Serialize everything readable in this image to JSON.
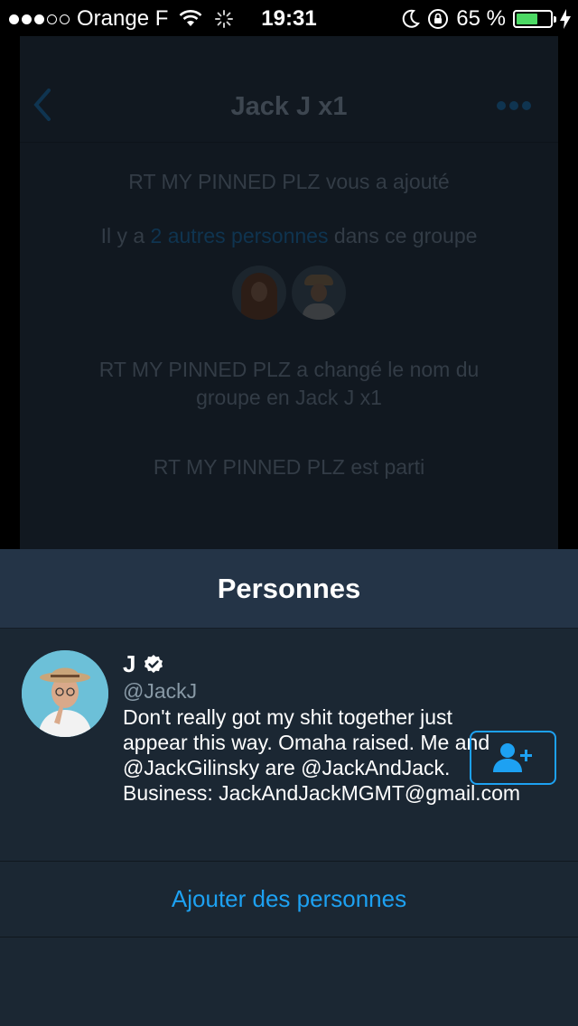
{
  "status_bar": {
    "carrier": "Orange F",
    "time": "19:31",
    "battery_text": "65 %",
    "battery_level": 0.65,
    "battery_color": "#4cd964"
  },
  "background_conversation": {
    "title": "Jack J x1",
    "back_icon": "chevron-left-icon",
    "more_icon": "more-dots-icon",
    "msg_added": "RT MY PINNED PLZ vous a ajouté",
    "msg_others_prefix": "Il y a ",
    "msg_others_link": "2 autres personnes",
    "msg_others_suffix": " dans ce groupe",
    "msg_renamed_line1": "RT MY PINNED PLZ a changé le nom du",
    "msg_renamed_line2": "groupe en Jack J x1",
    "msg_left": "RT MY PINNED PLZ est parti"
  },
  "sheet": {
    "title": "Personnes",
    "people": [
      {
        "name": "J",
        "verified": true,
        "handle": "@JackJ",
        "bio_lines": [
          "Don't really got my shit together just",
          "appear this way. Omaha raised. Me and",
          "@JackGilinsky are @JackAndJack.",
          "Business: JackAndJackMGMT@gmail.com"
        ],
        "follow_icon": "add-user-icon"
      }
    ],
    "add_people_label": "Ajouter des personnes"
  },
  "colors": {
    "accent": "#1da1f2",
    "sheet_bg": "#1b2733",
    "sheet_header_bg": "#243447",
    "muted_text": "#8899a6"
  }
}
